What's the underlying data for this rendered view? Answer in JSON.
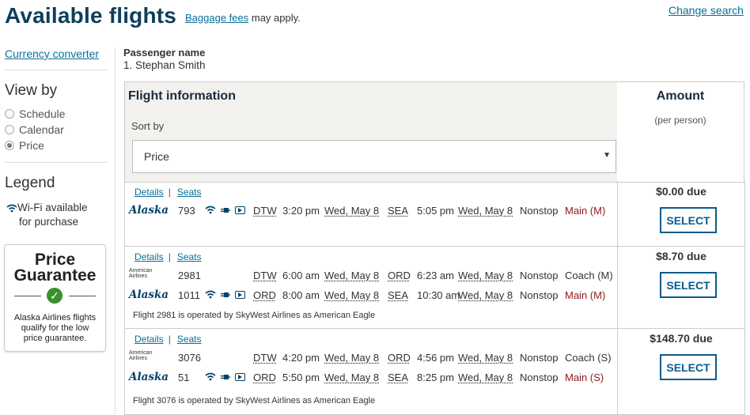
{
  "header": {
    "title": "Available flights",
    "baggage_link": "Baggage fees",
    "baggage_suffix": "may apply.",
    "change_search": "Change search"
  },
  "sidebar": {
    "currency_link": "Currency converter",
    "viewby_title": "View by",
    "viewby_options": [
      {
        "label": "Schedule",
        "selected": false
      },
      {
        "label": "Calendar",
        "selected": false
      },
      {
        "label": "Price",
        "selected": true
      }
    ],
    "legend_title": "Legend",
    "legend_wifi_line1": "Wi-Fi available",
    "legend_wifi_line2": "for purchase",
    "price_guarantee": {
      "title_line1": "Price",
      "title_line2": "Guarantee",
      "text_line1": "Alaska Airlines flights",
      "text_line2": "qualify for the low",
      "text_line3": "price guarantee."
    }
  },
  "passenger": {
    "label": "Passenger name",
    "name": "1.  Stephan Smith"
  },
  "table": {
    "flight_info_title": "Flight information",
    "sort_label": "Sort by",
    "sort_value": "Price",
    "amount_title": "Amount",
    "amount_sub": "(per person)"
  },
  "results": [
    {
      "details": "Details",
      "seats": "Seats",
      "segments": [
        {
          "airline": "Alaska",
          "flight": "793",
          "wifi": true,
          "from": "DTW",
          "dep_time": "3:20 pm",
          "dep_date": "Wed, May 8",
          "to": "SEA",
          "arr_time": "5:05 pm",
          "arr_date": "Wed, May 8",
          "stops": "Nonstop",
          "fare": "Main (M)"
        }
      ],
      "operated": "",
      "amount": "$0.00 due",
      "select": "SELECT"
    },
    {
      "details": "Details",
      "seats": "Seats",
      "segments": [
        {
          "airline": "American Airlines",
          "flight": "2981",
          "wifi": false,
          "from": "DTW",
          "dep_time": "6:00 am",
          "dep_date": "Wed, May 8",
          "to": "ORD",
          "arr_time": "6:23 am",
          "arr_date": "Wed, May 8",
          "stops": "Nonstop",
          "fare": "Coach (M)"
        },
        {
          "airline": "Alaska",
          "flight": "1011",
          "wifi": true,
          "from": "ORD",
          "dep_time": "8:00 am",
          "dep_date": "Wed, May 8",
          "to": "SEA",
          "arr_time": "10:30 am",
          "arr_date": "Wed, May 8",
          "stops": "Nonstop",
          "fare": "Main (M)"
        }
      ],
      "operated": "Flight 2981 is operated by SkyWest Airlines as American Eagle",
      "amount": "$8.70 due",
      "select": "SELECT"
    },
    {
      "details": "Details",
      "seats": "Seats",
      "segments": [
        {
          "airline": "American Airlines",
          "flight": "3076",
          "wifi": false,
          "from": "DTW",
          "dep_time": "4:20 pm",
          "dep_date": "Wed, May 8",
          "to": "ORD",
          "arr_time": "4:56 pm",
          "arr_date": "Wed, May 8",
          "stops": "Nonstop",
          "fare": "Coach (S)"
        },
        {
          "airline": "Alaska",
          "flight": "51",
          "wifi": true,
          "from": "ORD",
          "dep_time": "5:50 pm",
          "dep_date": "Wed, May 8",
          "to": "SEA",
          "arr_time": "8:25 pm",
          "arr_date": "Wed, May 8",
          "stops": "Nonstop",
          "fare": "Main (S)"
        }
      ],
      "operated": "Flight 3076 is operated by SkyWest Airlines as American Eagle",
      "amount": "$148.70 due",
      "select": "SELECT"
    }
  ],
  "colors": {
    "title": "#0c3f5c",
    "link": "#0a6e9b",
    "alaska_blue": "#01426a",
    "main_fare": "#8b1a1a",
    "select_border": "#0a5b8e",
    "check_green": "#3a8f2f"
  }
}
